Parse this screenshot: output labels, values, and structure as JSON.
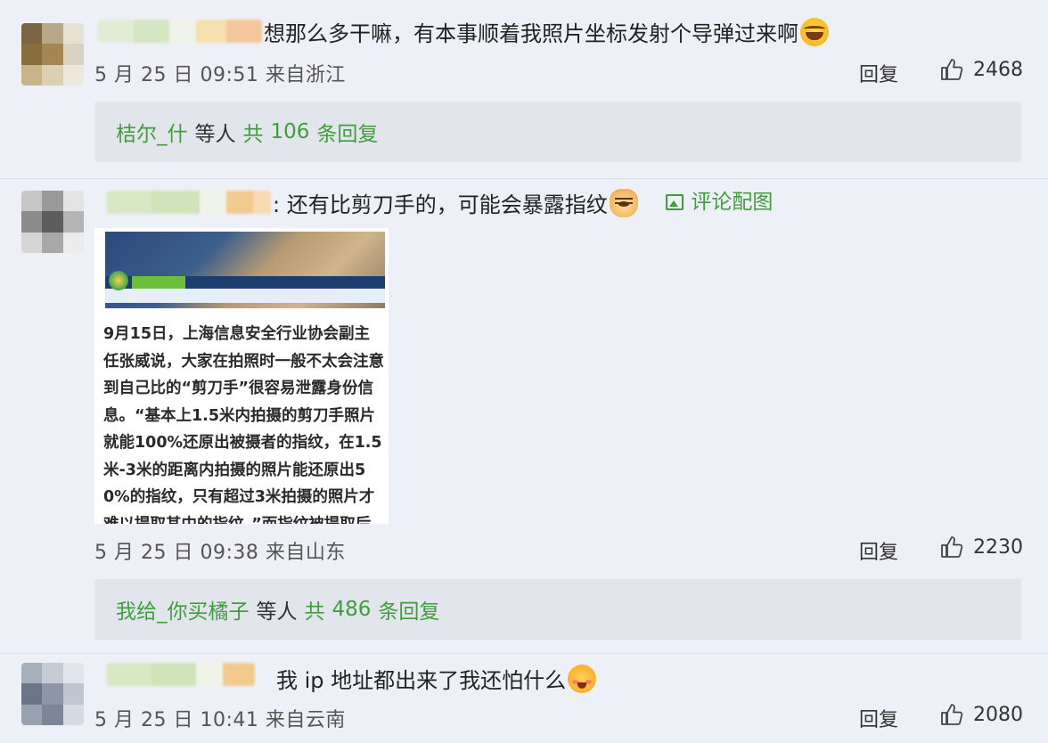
{
  "comments": [
    {
      "text": "想那么多干嘛，有本事顺着我照片坐标发射个导弹过来啊",
      "emoji": "laugh-emoji",
      "date": "5 月 25 日 09:51",
      "location": "来自浙江",
      "reply_label": "回复",
      "likes": "2468",
      "replies": {
        "user": "桔尔_什",
        "others": "等人",
        "total_prefix": "共",
        "count": "106",
        "suffix": "条回复"
      }
    },
    {
      "text": "还有比剪刀手的，可能会暴露指纹",
      "emoji": "dog-emoji",
      "image_link_label": "评论配图",
      "date": "5 月 25 日 09:38",
      "location": "来自山东",
      "reply_label": "回复",
      "likes": "2230",
      "image_text": "9月15日，上海信息安全行业协会副主任张威说，大家在拍照时一般不太会注意到自己比的“剪刀手”很容易泄露身份信息。“基本上1.5米内拍摄的剪刀手照片就能100%还原出被摄者的指纹，在1.5米-3米的距离内拍摄的照片能还原出50%的指纹，只有超过3米拍摄的照片才难以提取其中的指纹。”而指纹被提取后",
      "replies": {
        "user": "我给_你买橘子",
        "others": "等人",
        "total_prefix": "共",
        "count": "486",
        "suffix": "条回复"
      }
    },
    {
      "text": "我 ip 地址都出来了我还怕什么",
      "emoji": "blush-emoji",
      "date": "5 月 25 日 10:41",
      "location": "来自云南",
      "reply_label": "回复",
      "likes": "2080"
    }
  ],
  "colors": {
    "background": "#eef0f7",
    "reply_box": "#e3e5ed",
    "link_green": "#3f9e3a",
    "meta_gray": "#555555"
  }
}
